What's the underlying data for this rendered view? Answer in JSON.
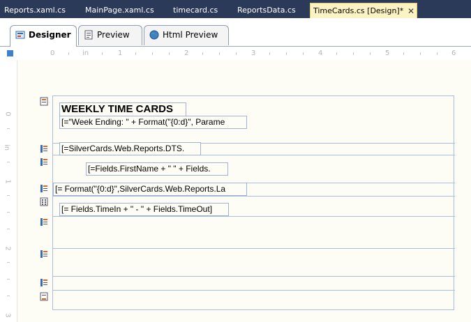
{
  "document_tabs": [
    {
      "label": "Reports.xaml.cs"
    },
    {
      "label": "MainPage.xaml.cs"
    },
    {
      "label": "timecard.cs"
    },
    {
      "label": "ReportsData.cs"
    },
    {
      "label": "TimeCards.cs [Design]*",
      "active": true
    }
  ],
  "view_tabs": [
    {
      "label": "Designer",
      "icon": "designer-icon",
      "active": true
    },
    {
      "label": "Preview",
      "icon": "preview-icon"
    },
    {
      "label": "Html Preview",
      "icon": "globe-icon"
    }
  ],
  "ruler": {
    "unit": "in",
    "top_numbers": [
      "0",
      "1",
      "2",
      "3",
      "4",
      "5",
      "6"
    ],
    "left_numbers": [
      "0",
      "1",
      "2",
      "3"
    ]
  },
  "report": {
    "title": "WEEKLY TIME CARDS",
    "fields": {
      "week_ending": "[=\"Week Ending: \" + Format(\"{0:d}\", Parame",
      "dts": "[=SilverCards.Web.Reports.DTS.",
      "name": "[=Fields.FirstName + \" \" + Fields.",
      "format_date": "[= Format(\"{0:d}\",SilverCards.Web.Reports.La",
      "time_in_out": "[= Fields.TimeIn + \" - \" + Fields.TimeOut]"
    }
  },
  "colors": {
    "tab_strip_bg": "#2b3a58",
    "active_tab_bg": "#fcf3c4",
    "textbox_border": "#9fb2d6",
    "canvas_bg": "#fdfdf5"
  }
}
